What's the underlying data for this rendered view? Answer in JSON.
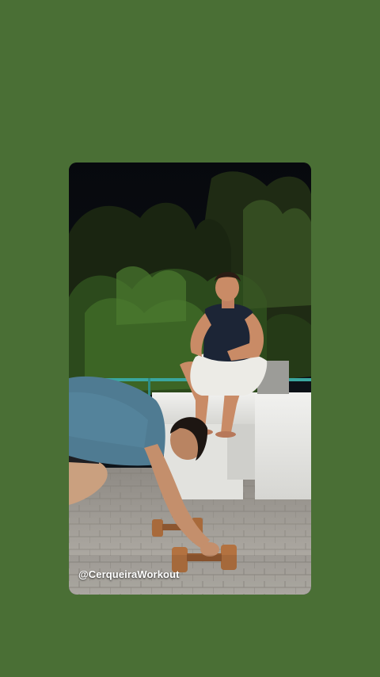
{
  "background_color": "#4a6f35",
  "story": {
    "image_description_icon": "workout-photo",
    "watermark": "@CerqueiraWorkout"
  }
}
